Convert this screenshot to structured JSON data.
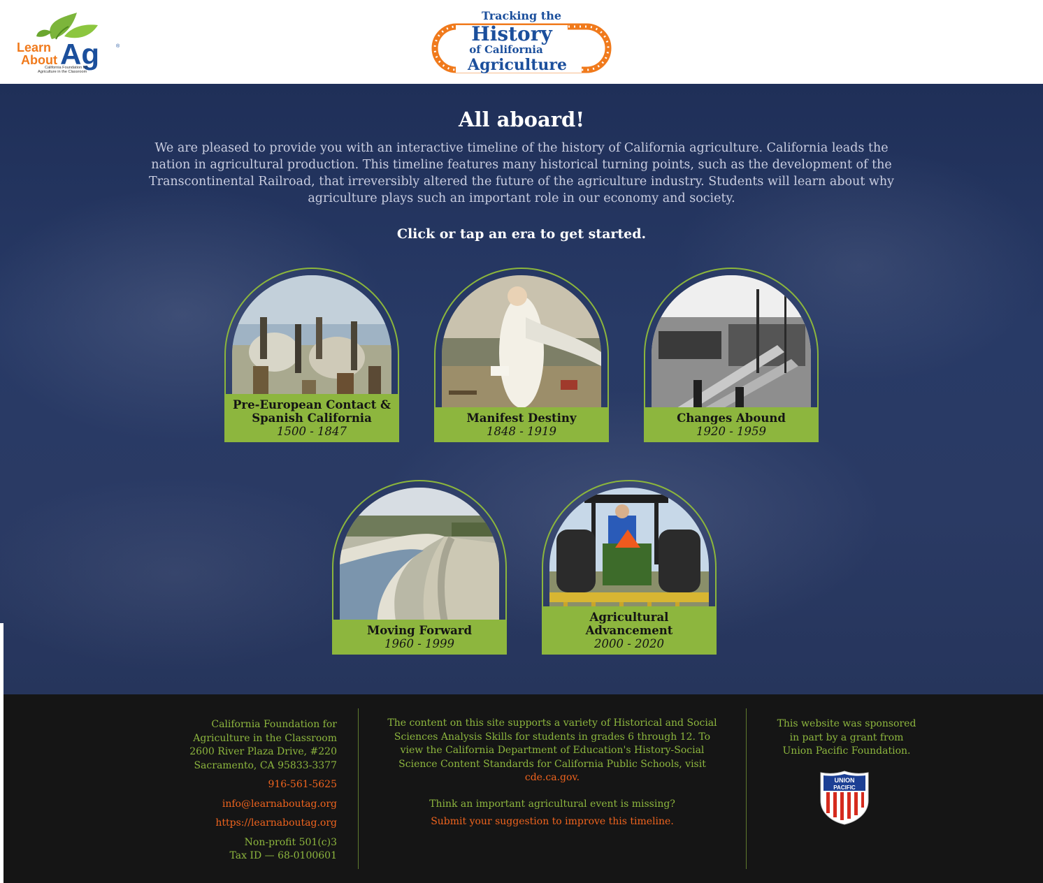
{
  "header": {
    "learn_logo": {
      "word1": "Learn",
      "word2": "About",
      "word3": "Ag",
      "registered": "®",
      "tagline_line1": "California Foundation for",
      "tagline_line2": "Agriculture in the Classroom"
    },
    "tracking_logo": {
      "line1": "Tracking the",
      "line2": "History",
      "line3": "of California",
      "line4": "Agriculture"
    }
  },
  "hero": {
    "title": "All aboard!",
    "intro_line1": "We are pleased to provide you with an interactive timeline of the history of California agriculture. California leads the",
    "intro_line2": "nation in agricultural production. This timeline features many historical turning points, such as the development of the",
    "intro_line3": "Transcontinental Railroad, that irreversibly altered the future of the agriculture industry. Students will learn about why",
    "intro_line4": "agriculture plays such an important role in our economy and society.",
    "cta": "Click or tap an era to get started."
  },
  "eras": [
    {
      "title_line1": "Pre-European Contact &",
      "title_line2": "Spanish California",
      "years": "1500 - 1847",
      "image": "spanish-explorers-painting"
    },
    {
      "title_line1": "Manifest Destiny",
      "title_line2": "",
      "years": "1848 - 1919",
      "image": "american-progress-painting"
    },
    {
      "title_line1": "Changes Abound",
      "title_line2": "",
      "years": "1920 - 1959",
      "image": "lumber-shipyard-photo"
    },
    {
      "title_line1": "Moving Forward",
      "title_line2": "",
      "years": "1960 - 1999",
      "image": "aqueduct-canal-photo"
    },
    {
      "title_line1": "Agricultural",
      "title_line2": "Advancement",
      "years": "2000 - 2020",
      "image": "tractor-cultivator-photo"
    }
  ],
  "footer": {
    "org_name_line1": "California Foundation for",
    "org_name_line2": "Agriculture in the Classroom",
    "address_line1": "2600 River Plaza Drive, #220",
    "address_line2": "Sacramento, CA 95833-3377",
    "phone": "916-561-5625",
    "email": "info@learnaboutag.org",
    "website": "https://learnaboutag.org",
    "nonprofit_line1": "Non-profit 501(c)3",
    "nonprofit_line2": "Tax ID — 68-0100601",
    "standards_line1": "The content on this site supports a variety of Historical and Social",
    "standards_line2": "Sciences Analysis Skills for students in grades 6 through 12. To",
    "standards_line3": "view the California Department of Education's History-Social",
    "standards_line4": "Science Content Standards for California Public Schools, visit",
    "standards_link": "cde.ca.gov.",
    "missing_prompt": "Think an important agricultural event is missing?",
    "suggestion_link": "Submit your suggestion to improve this timeline.",
    "sponsor_line1": "This website was sponsored",
    "sponsor_line2": "in part by a grant from",
    "sponsor_line3": "Union Pacific Foundation.",
    "sponsor_logo": {
      "line1": "UNION",
      "line2": "PACIFIC"
    }
  },
  "colors": {
    "accent_green": "#8db63e",
    "link_orange": "#f0641e",
    "hero_navy": "#283a66",
    "footer_bg": "#151515",
    "logo_blue": "#1b4f9c",
    "logo_orange": "#f07a1c"
  }
}
